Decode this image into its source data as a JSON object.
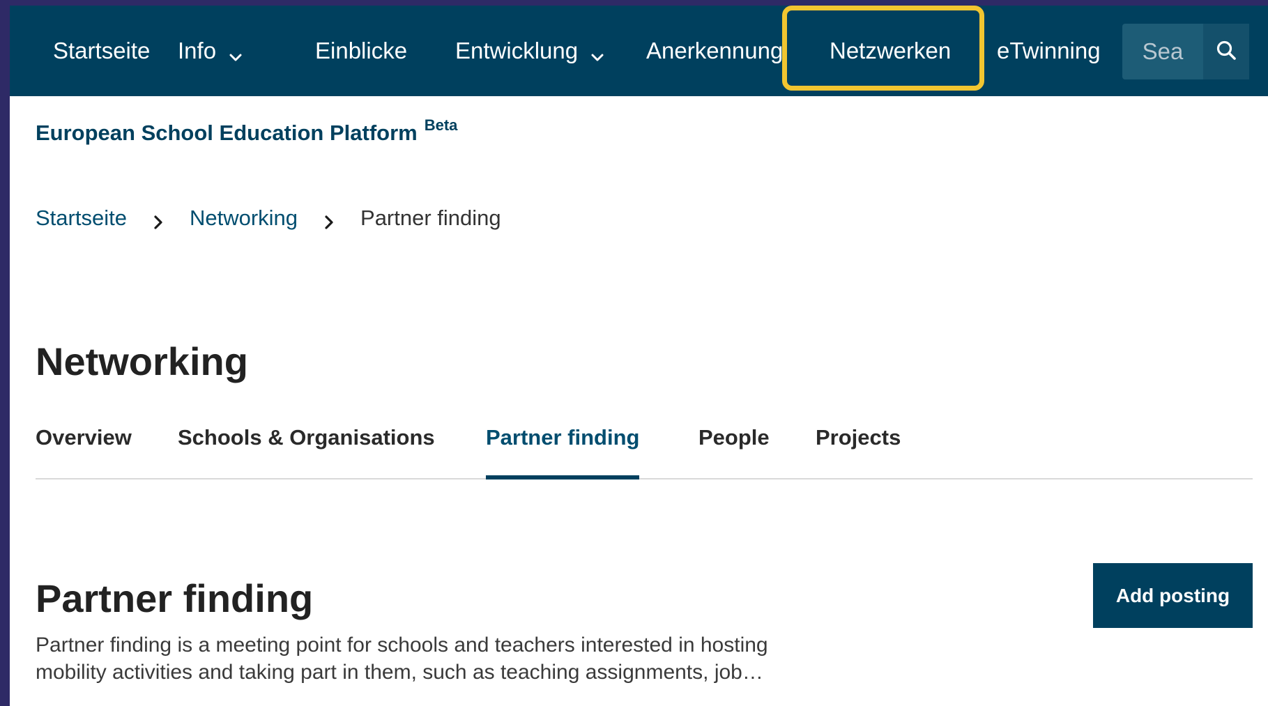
{
  "colors": {
    "brand_dark": "#00405e",
    "link": "#004d6f",
    "highlight": "#f2c530",
    "outer_frame": "#2e2a66"
  },
  "nav": {
    "items": [
      {
        "label": "Startseite",
        "has_dropdown": false
      },
      {
        "label": "Info",
        "has_dropdown": true
      },
      {
        "label": "Einblicke",
        "has_dropdown": false
      },
      {
        "label": "Entwicklung",
        "has_dropdown": true
      },
      {
        "label": "Anerkennung",
        "has_dropdown": false
      },
      {
        "label": "Netzwerken",
        "has_dropdown": false,
        "highlighted": true
      },
      {
        "label": "eTwinning",
        "has_dropdown": false
      }
    ],
    "search": {
      "placeholder": "Sea",
      "icon": "search-icon"
    }
  },
  "site": {
    "name": "European School Education Platform",
    "badge": "Beta"
  },
  "breadcrumb": {
    "items": [
      "Startseite",
      "Networking",
      "Partner finding"
    ]
  },
  "section": {
    "title": "Networking",
    "tabs": [
      {
        "label": "Overview",
        "active": false
      },
      {
        "label": "Schools & Organisations",
        "active": false
      },
      {
        "label": "Partner finding",
        "active": true
      },
      {
        "label": "People",
        "active": false
      },
      {
        "label": "Projects",
        "active": false
      }
    ]
  },
  "page": {
    "heading": "Partner finding",
    "add_button": "Add posting",
    "description": "Partner finding is a meeting point for schools and teachers interested in hosting mobility activities and taking part in them, such as teaching assignments, job…"
  }
}
